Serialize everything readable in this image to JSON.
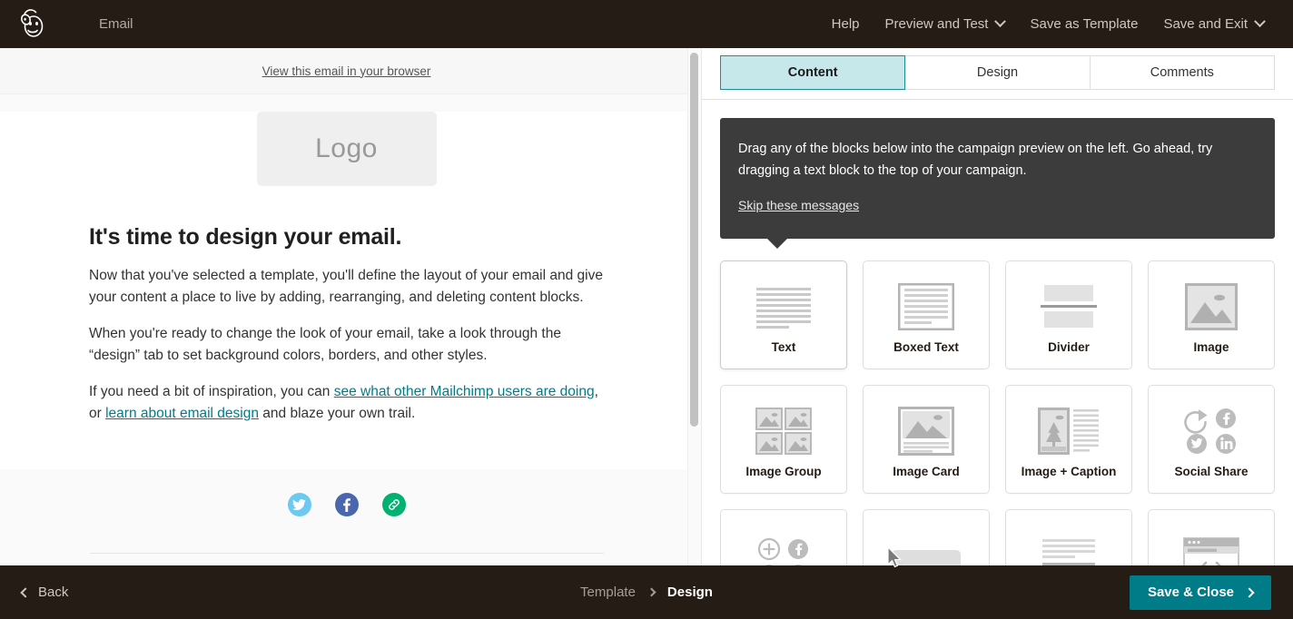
{
  "topbar": {
    "logo_icon": "mailchimp-monkey-logo",
    "app_label": "Email",
    "nav": [
      {
        "label": "Help",
        "caret": false
      },
      {
        "label": "Preview and Test",
        "caret": true
      },
      {
        "label": "Save as Template",
        "caret": false
      },
      {
        "label": "Save and Exit",
        "caret": true
      }
    ]
  },
  "preview": {
    "browser_link": "View this email in your browser",
    "logo_placeholder": "Logo",
    "heading": "It's time to design your email.",
    "paragraph1": "Now that you've selected a template, you'll define the layout of your email and give your content a place to live by adding, rearranging, and deleting content blocks.",
    "paragraph2": "When you're ready to change the look of your email, take a look through the “design” tab to set background colors, borders, and other styles.",
    "paragraph3_pre": "If you need a bit of inspiration, you can ",
    "paragraph3_link1": "see what other Mailchimp users are doing",
    "paragraph3_mid": ", or ",
    "paragraph3_link2": "learn about email design",
    "paragraph3_post": " and blaze your own trail.",
    "social": [
      {
        "name": "twitter-icon",
        "color": "#6cc9f0"
      },
      {
        "name": "facebook-icon",
        "color": "#4a67ad"
      },
      {
        "name": "link-icon",
        "color": "#00b272"
      }
    ]
  },
  "panel": {
    "tabs": [
      {
        "label": "Content",
        "active": true
      },
      {
        "label": "Design",
        "active": false
      },
      {
        "label": "Comments",
        "active": false
      }
    ],
    "tip": {
      "message": "Drag any of the blocks below into the campaign preview on the left. Go ahead, try dragging a text block to the top of your campaign.",
      "skip_label": "Skip these messages"
    },
    "blocks": [
      {
        "label": "Text",
        "icon": "text-lines-icon"
      },
      {
        "label": "Boxed Text",
        "icon": "boxed-text-icon"
      },
      {
        "label": "Divider",
        "icon": "divider-icon"
      },
      {
        "label": "Image",
        "icon": "image-icon"
      },
      {
        "label": "Image Group",
        "icon": "image-group-icon"
      },
      {
        "label": "Image Card",
        "icon": "image-card-icon"
      },
      {
        "label": "Image + Caption",
        "icon": "image-caption-icon"
      },
      {
        "label": "Social Share",
        "icon": "social-share-icon"
      },
      {
        "label": "",
        "icon": "social-follow-icon"
      },
      {
        "label": "",
        "icon": "button-icon"
      },
      {
        "label": "",
        "icon": "footer-icon"
      },
      {
        "label": "",
        "icon": "code-icon"
      }
    ]
  },
  "bottombar": {
    "back_label": "Back",
    "breadcrumb_previous": "Template",
    "breadcrumb_current": "Design",
    "save_close_label": "Save & Close"
  },
  "colors": {
    "chrome": "#241c15",
    "accent_teal": "#007c89",
    "tab_active_bg": "#c7e8ea",
    "tooltip_bg": "#3c3c3c"
  }
}
